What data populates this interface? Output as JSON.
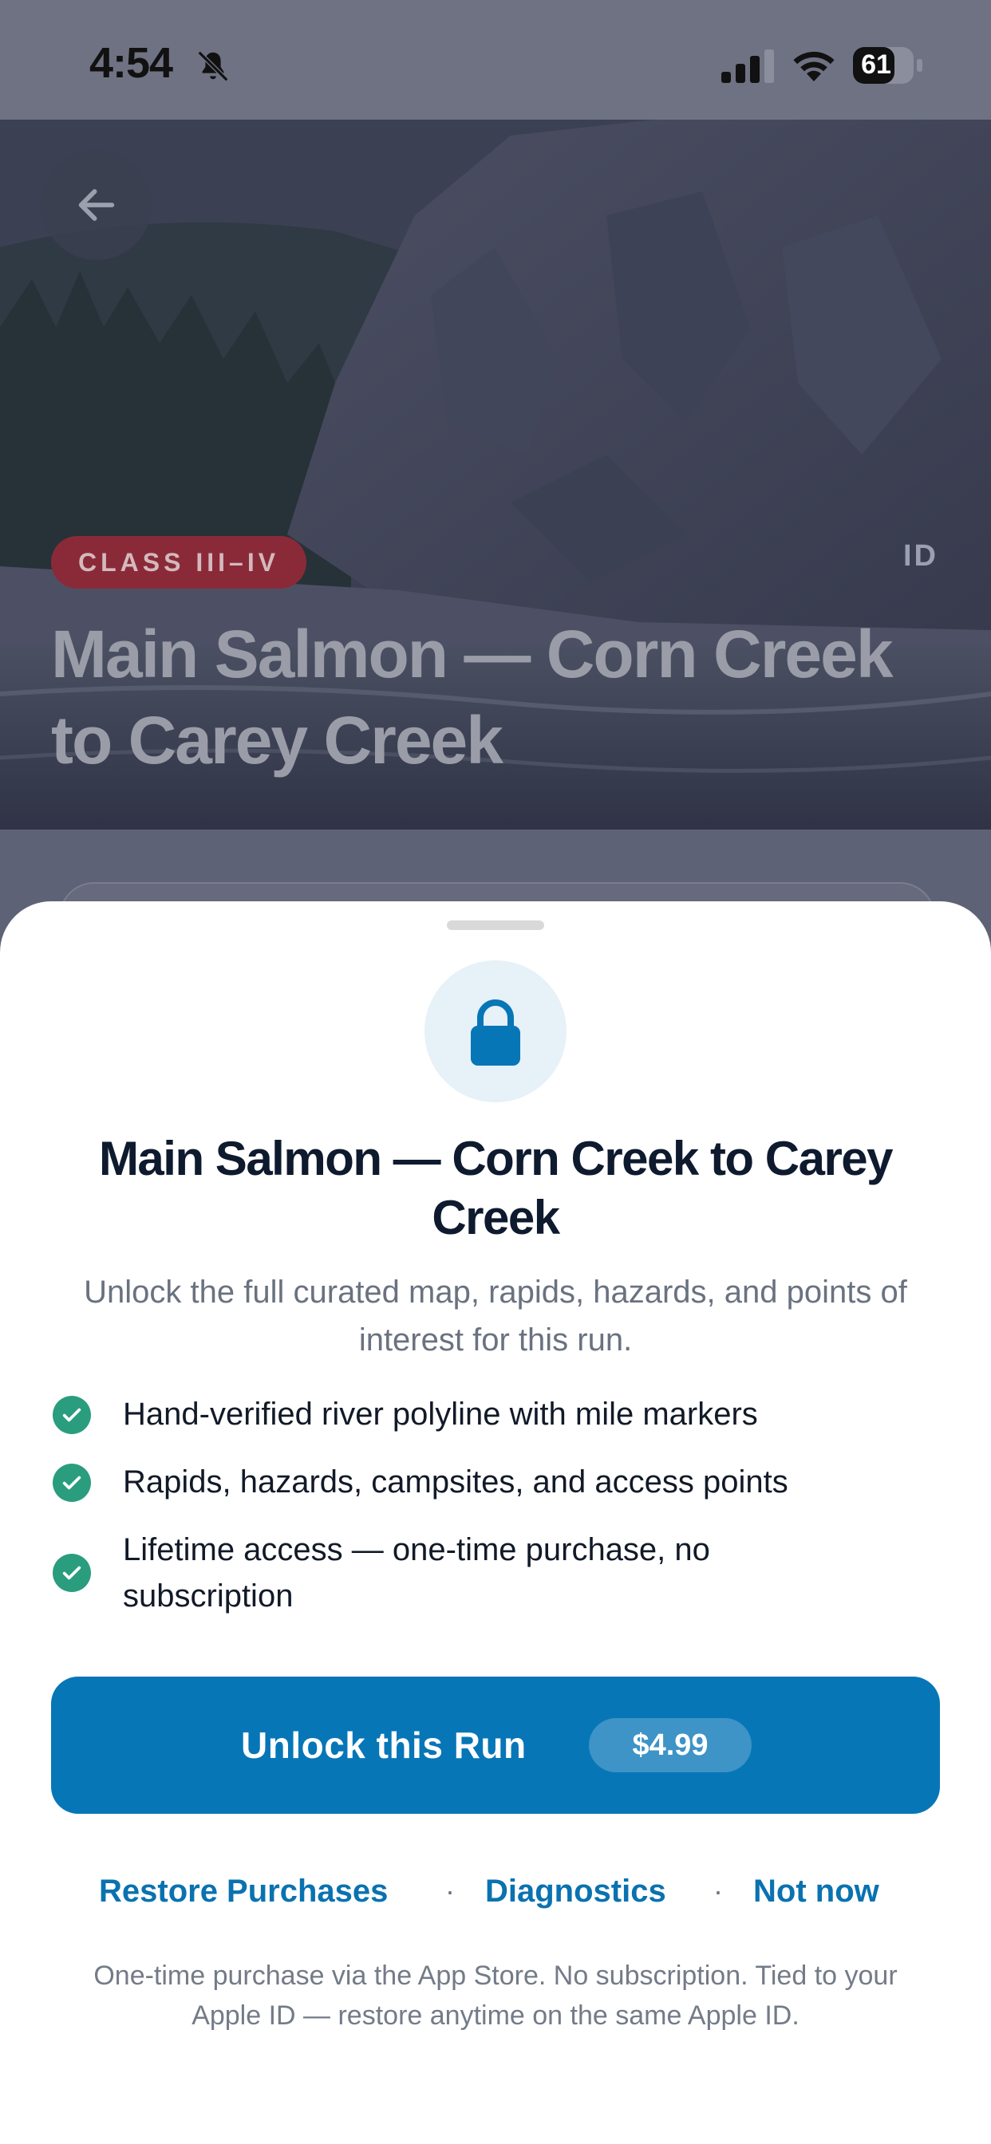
{
  "status_bar": {
    "time": "4:54",
    "battery": "61",
    "icons": [
      "bell-slash-icon",
      "signal-icon",
      "wifi-icon",
      "battery-icon"
    ]
  },
  "hero": {
    "badge": "CLASS III–IV",
    "state": "ID",
    "title": "Main Salmon — Corn Creek to Carey Creek",
    "back_icon": "arrow-left-icon"
  },
  "sheet": {
    "title": "Main Salmon — Corn Creek to Carey Creek",
    "subtitle": "Unlock the full curated map, rapids, hazards, and points of interest for this run.",
    "features": [
      "Hand-verified river polyline with mile markers",
      "Rapids, hazards, campsites, and access points",
      "Lifetime access — one-time purchase, no subscription"
    ],
    "unlock_label": "Unlock this Run",
    "price": "$4.99",
    "links": {
      "restore": "Restore Purchases",
      "diagnostics": "Diagnostics",
      "not_now": "Not now",
      "separator": "·"
    },
    "footnote": "One-time purchase via the App Store. No subscription. Tied to your Apple ID — restore anytime on the same Apple ID."
  },
  "colors": {
    "accent": "#0676b7",
    "check": "#2a9d7e",
    "badge": "#8a2a38"
  }
}
